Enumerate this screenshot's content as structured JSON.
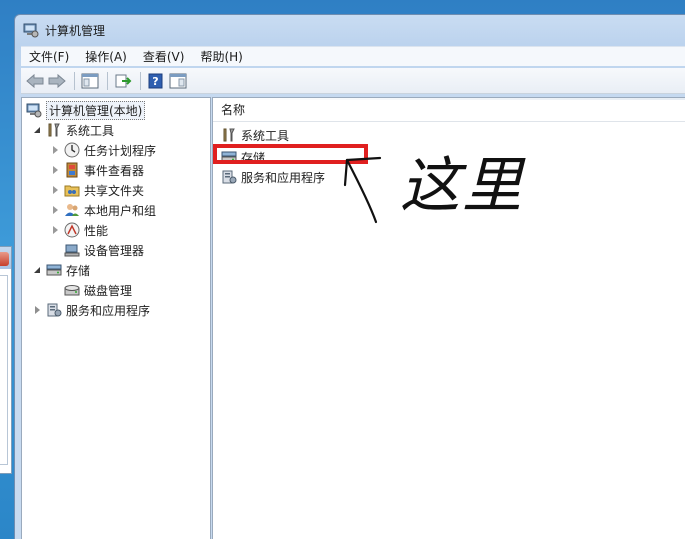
{
  "window": {
    "title": "计算机管理"
  },
  "menubar": {
    "items": [
      "文件(F)",
      "操作(A)",
      "查看(V)",
      "帮助(H)"
    ]
  },
  "toolbar": {
    "buttons": [
      "back-arrow-icon",
      "forward-arrow-icon",
      "show-hide-console-tree-icon",
      "export-list-icon",
      "help-icon",
      "show-hide-action-pane-icon"
    ]
  },
  "tree": {
    "root": "计算机管理(本地)",
    "system_tools": "系统工具",
    "task_scheduler": "任务计划程序",
    "event_viewer": "事件查看器",
    "shared_folders": "共享文件夹",
    "local_users": "本地用户和组",
    "performance": "性能",
    "device_manager": "设备管理器",
    "storage": "存储",
    "disk_management": "磁盘管理",
    "services_apps": "服务和应用程序"
  },
  "list": {
    "column_name": "名称",
    "items": [
      "系统工具",
      "存储",
      "服务和应用程序"
    ]
  },
  "annotation": {
    "handwritten_text": "这里",
    "highlight_color": "#e02020"
  }
}
